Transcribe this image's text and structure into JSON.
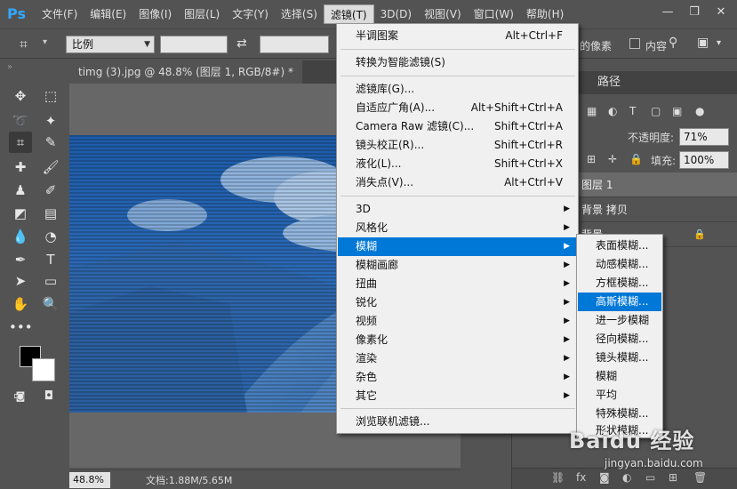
{
  "app": {
    "logo": "Ps",
    "accent": "#31a8ff"
  },
  "menubar": {
    "items": [
      {
        "label": "文件(F)"
      },
      {
        "label": "编辑(E)"
      },
      {
        "label": "图像(I)"
      },
      {
        "label": "图层(L)"
      },
      {
        "label": "文字(Y)"
      },
      {
        "label": "选择(S)"
      },
      {
        "label": "滤镜(T)",
        "active": true
      },
      {
        "label": "3D(D)"
      },
      {
        "label": "视图(V)"
      },
      {
        "label": "窗口(W)"
      },
      {
        "label": "帮助(H)"
      }
    ],
    "window_controls": {
      "minimize": "—",
      "restore": "❐",
      "close": "✕"
    }
  },
  "options_bar": {
    "ratio_select": "比例",
    "partial_text_1": "的像素",
    "partial_text_2": "内容"
  },
  "document": {
    "tab_title": "timg (3).jpg @ 48.8% (图层 1, RGB/8#) *",
    "zoom": "48.8%",
    "doc_info": "文档:1.88M/5.65M",
    "image_tint": "#1f5faa"
  },
  "filter_menu": {
    "items": [
      {
        "label": "半调图案",
        "shortcut": "Alt+Ctrl+F"
      },
      {
        "label": "转换为智能滤镜(S)",
        "shortcut": ""
      },
      {
        "label": "滤镜库(G)...",
        "shortcut": ""
      },
      {
        "label": "自适应广角(A)...",
        "shortcut": "Alt+Shift+Ctrl+A"
      },
      {
        "label": "Camera Raw 滤镜(C)...",
        "shortcut": "Shift+Ctrl+A"
      },
      {
        "label": "镜头校正(R)...",
        "shortcut": "Shift+Ctrl+R"
      },
      {
        "label": "液化(L)...",
        "shortcut": "Shift+Ctrl+X"
      },
      {
        "label": "消失点(V)...",
        "shortcut": "Alt+Ctrl+V"
      },
      {
        "label": "3D",
        "submenu": true
      },
      {
        "label": "风格化",
        "submenu": true
      },
      {
        "label": "模糊",
        "submenu": true,
        "highlighted": true
      },
      {
        "label": "模糊画廊",
        "submenu": true
      },
      {
        "label": "扭曲",
        "submenu": true
      },
      {
        "label": "锐化",
        "submenu": true
      },
      {
        "label": "视频",
        "submenu": true
      },
      {
        "label": "像素化",
        "submenu": true
      },
      {
        "label": "渲染",
        "submenu": true
      },
      {
        "label": "杂色",
        "submenu": true
      },
      {
        "label": "其它",
        "submenu": true
      },
      {
        "label": "浏览联机滤镜...",
        "shortcut": ""
      }
    ],
    "submenu_arrow": "▶"
  },
  "blur_submenu": {
    "items": [
      {
        "label": "表面模糊..."
      },
      {
        "label": "动感模糊..."
      },
      {
        "label": "方框模糊..."
      },
      {
        "label": "高斯模糊...",
        "highlighted": true
      },
      {
        "label": "进一步模糊"
      },
      {
        "label": "径向模糊..."
      },
      {
        "label": "镜头模糊..."
      },
      {
        "label": "模糊"
      },
      {
        "label": "平均"
      },
      {
        "label": "特殊模糊..."
      },
      {
        "label": "形状模糊..."
      }
    ]
  },
  "right_panel": {
    "tab_paths": "路径",
    "opacity_label": "不透明度:",
    "opacity_value": "71%",
    "fill_label": "填充:",
    "fill_value": "100%",
    "layers": [
      {
        "name": "图层 1",
        "selected": true
      },
      {
        "name": "背景 拷贝"
      },
      {
        "name": "背景",
        "locked": true
      }
    ],
    "bottom_fx": "fx"
  },
  "watermark": {
    "text": "Baidu 经验",
    "sub": "jingyan.baidu.com"
  }
}
